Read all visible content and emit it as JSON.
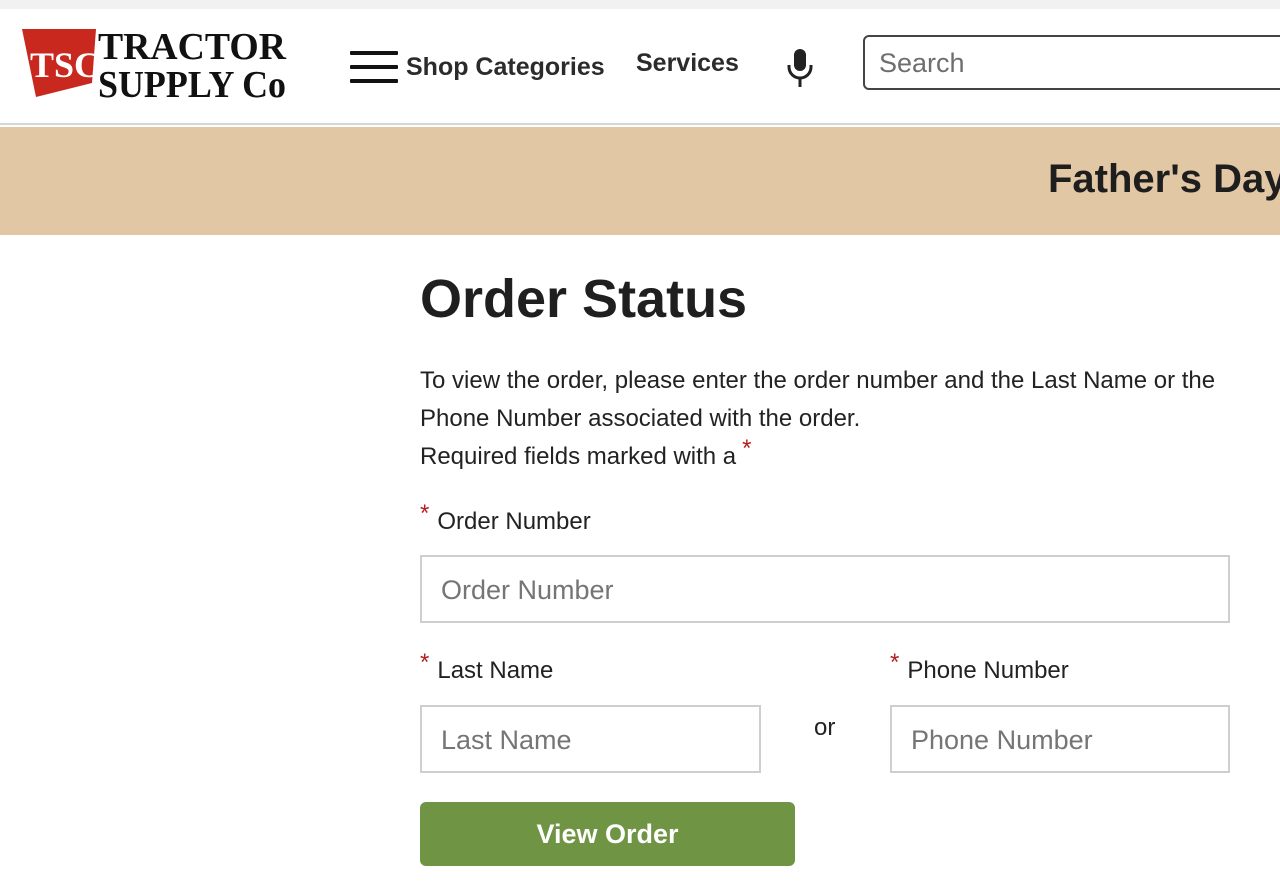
{
  "brand": {
    "logo_alt": "Tractor Supply Co",
    "logo_badge": "TSC",
    "logo_line1": "TRACTOR",
    "logo_line2": "SUPPLY Co",
    "colors": {
      "badge_red": "#c8281e",
      "text": "#111111"
    }
  },
  "nav": {
    "shop_categories": "Shop Categories",
    "services": "Services",
    "icons": [
      "hamburger-icon",
      "microphone-icon"
    ]
  },
  "search": {
    "placeholder": "Search",
    "value": ""
  },
  "banner": {
    "text": "Father's Day",
    "background": "#e2c7a5"
  },
  "page": {
    "title": "Order Status",
    "intro": "To view the order, please enter the order number and the Last Name or the Phone Number associated with the order.",
    "required_note": "Required fields marked with a",
    "required_marker": "*"
  },
  "form": {
    "order_number": {
      "label": "Order Number",
      "placeholder": "Order Number",
      "value": ""
    },
    "last_name": {
      "label": "Last Name",
      "placeholder": "Last Name",
      "value": ""
    },
    "or_text": "or",
    "phone_number": {
      "label": "Phone Number",
      "placeholder": "Phone Number",
      "value": ""
    },
    "submit_label": "View Order",
    "accent_color": "#6f9443",
    "required_color": "#b02020"
  }
}
